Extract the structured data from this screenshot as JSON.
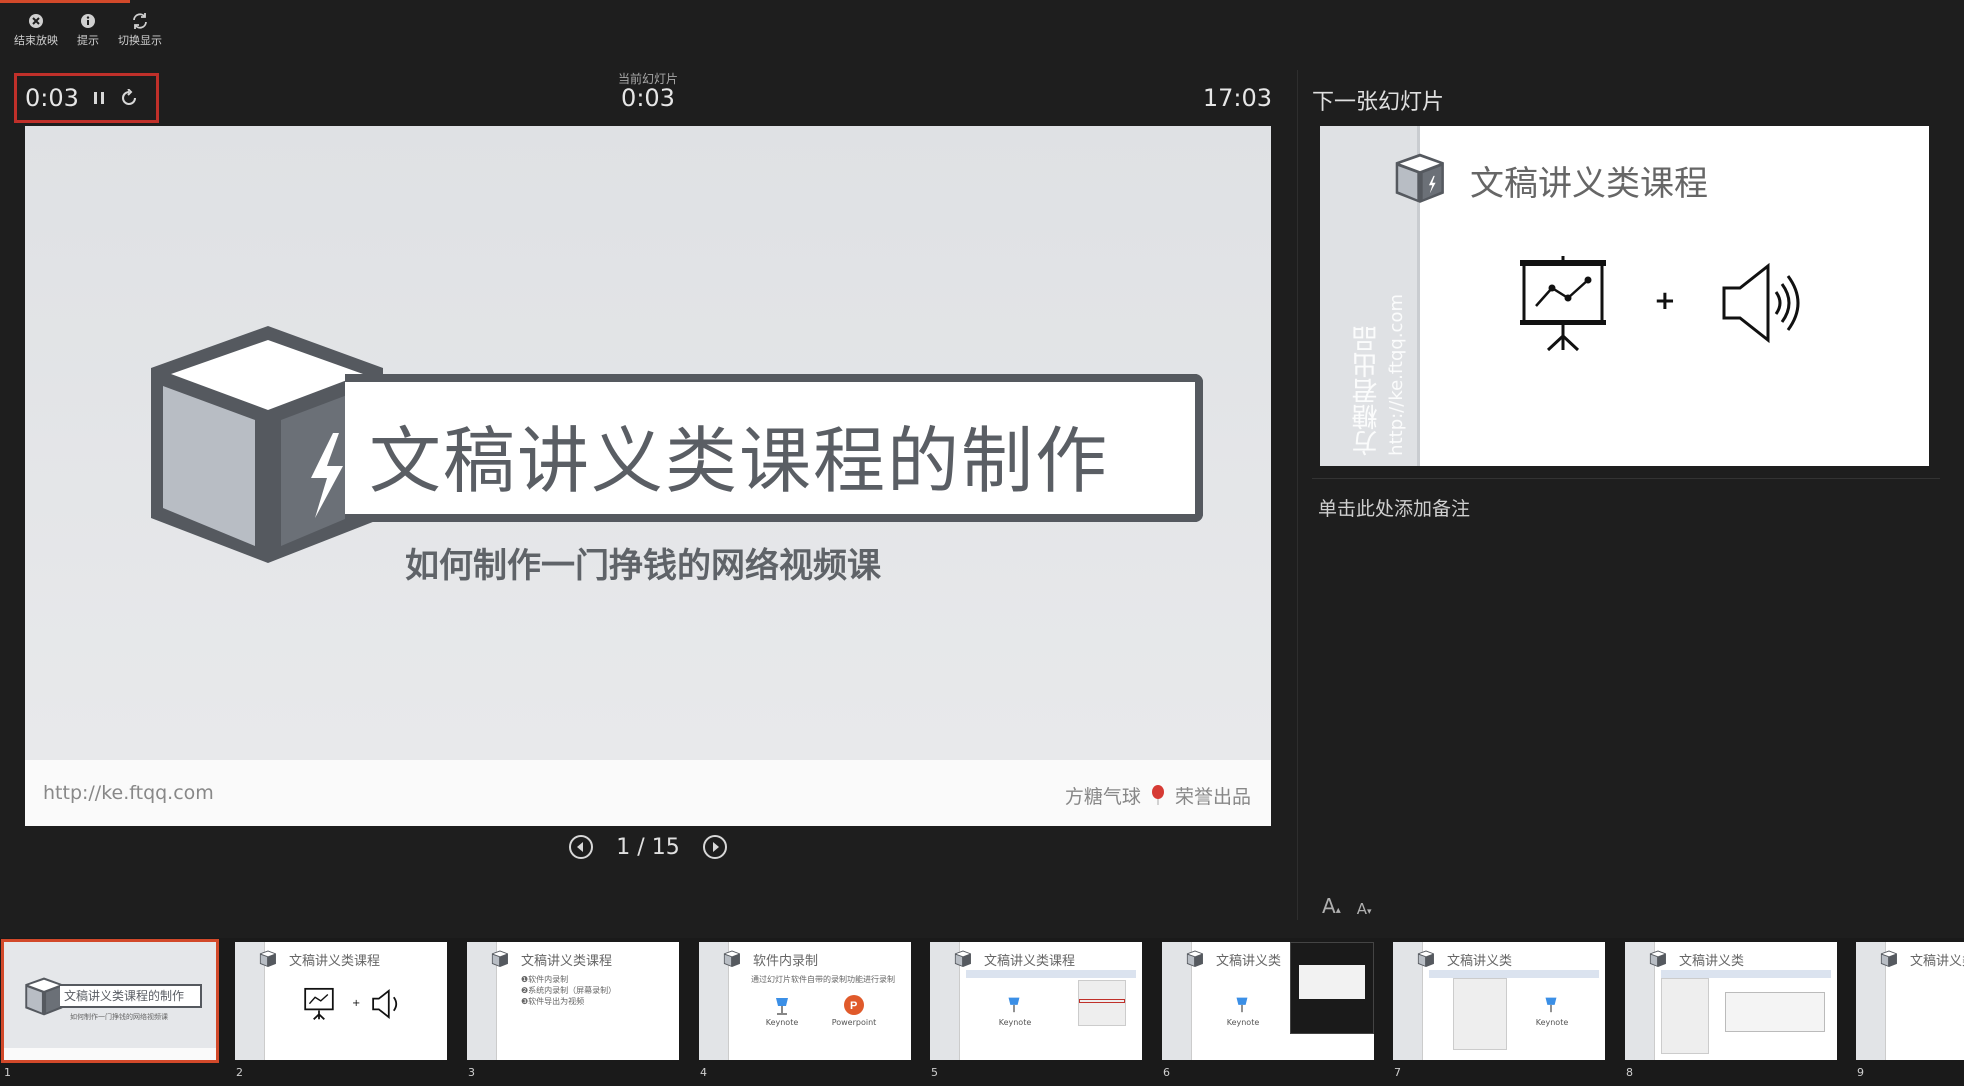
{
  "toolbar": {
    "end_show": "结束放映",
    "hint": "提示",
    "switch_display": "切换显示"
  },
  "timer": {
    "elapsed": "0:03"
  },
  "current_slide": {
    "label": "当前幻灯片",
    "time": "0:03"
  },
  "clock": "17:03",
  "slide": {
    "title": "文稿讲义类课程的制作",
    "subtitle": "如何制作一门挣钱的网络视频课",
    "footer_url": "http://ke.ftqq.com",
    "footer_brand_prefix": "方糖气球",
    "footer_brand_suffix": "荣誉出品",
    "accent_color": "#c0302a"
  },
  "navigation": {
    "counter": "1 / 15"
  },
  "next_slide": {
    "label": "下一张幻灯片",
    "title": "文稿讲义类课程",
    "side_text": "方糖君出品",
    "side_url": "http://ke.ftqq.com",
    "plus": "+"
  },
  "notes_placeholder": "单击此处添加备注",
  "font_controls": {
    "increase": "A",
    "decrease": "A"
  },
  "thumbnails": [
    {
      "num": "1",
      "title": "文稿讲义类课程的制作",
      "sub": "如何制作一门挣钱的网络视频课",
      "active": true
    },
    {
      "num": "2",
      "title": "文稿讲义类课程"
    },
    {
      "num": "3",
      "title": "文稿讲义类课程",
      "bullets": [
        "❶软件内录制",
        "❷系统内录制（屏幕录制）",
        "❸软件导出为视频"
      ]
    },
    {
      "num": "4",
      "title": "软件内录制",
      "desc": "通过幻灯片软件自带的录制功能进行录制",
      "apps": [
        "Keynote",
        "Powerpoint"
      ]
    },
    {
      "num": "5",
      "title": "文稿讲义类课程",
      "apps": [
        "Keynote"
      ]
    },
    {
      "num": "6",
      "title": "文稿讲义类",
      "apps": [
        "Keynote"
      ]
    },
    {
      "num": "7",
      "title": "文稿讲义类",
      "apps": [
        "Keynote"
      ]
    },
    {
      "num": "8",
      "title": "文稿讲义类"
    },
    {
      "num": "9",
      "title": "文稿讲义类"
    }
  ]
}
